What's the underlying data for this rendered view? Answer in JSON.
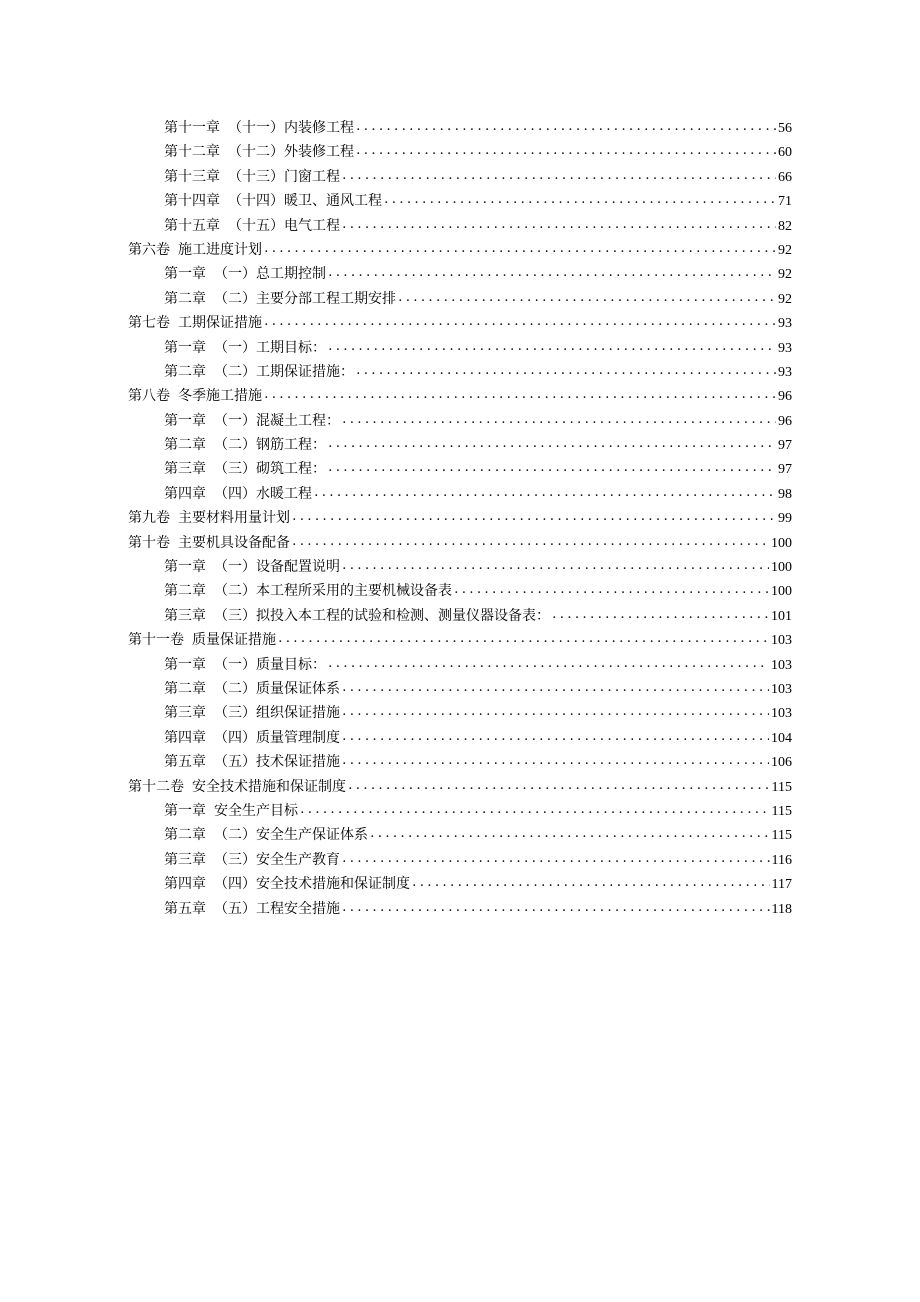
{
  "toc": [
    {
      "level": "chap",
      "label": "第十一章",
      "title": "（十一）内装修工程",
      "page": "56"
    },
    {
      "level": "chap",
      "label": "第十二章",
      "title": "（十二）外装修工程",
      "page": "60"
    },
    {
      "level": "chap",
      "label": "第十三章",
      "title": "（十三）门窗工程",
      "page": "66"
    },
    {
      "level": "chap",
      "label": "第十四章",
      "title": "（十四）暖卫、通风工程",
      "page": "71"
    },
    {
      "level": "chap",
      "label": "第十五章",
      "title": "（十五）电气工程",
      "page": "82"
    },
    {
      "level": "vol",
      "label": "第六卷",
      "title": "施工进度计划",
      "page": "92"
    },
    {
      "level": "chap",
      "label": "第一章",
      "title": "（一）总工期控制",
      "page": "92"
    },
    {
      "level": "chap",
      "label": "第二章",
      "title": "（二）主要分部工程工期安排",
      "page": "92"
    },
    {
      "level": "vol",
      "label": "第七卷",
      "title": "工期保证措施",
      "page": "93"
    },
    {
      "level": "chap",
      "label": "第一章",
      "title": "（一）工期目标：",
      "page": "93"
    },
    {
      "level": "chap",
      "label": "第二章",
      "title": "（二）工期保证措施：",
      "page": "93"
    },
    {
      "level": "vol",
      "label": "第八卷",
      "title": "冬季施工措施",
      "page": "96"
    },
    {
      "level": "chap",
      "label": "第一章",
      "title": "（一）混凝土工程：",
      "page": "96"
    },
    {
      "level": "chap",
      "label": "第二章",
      "title": "（二）钢筋工程：",
      "page": "97"
    },
    {
      "level": "chap",
      "label": "第三章",
      "title": "（三）砌筑工程：",
      "page": "97"
    },
    {
      "level": "chap",
      "label": "第四章",
      "title": "（四）水暖工程",
      "page": "98"
    },
    {
      "level": "vol",
      "label": "第九卷",
      "title": "主要材料用量计划",
      "page": "99"
    },
    {
      "level": "vol",
      "label": "第十卷",
      "title": "主要机具设备配备",
      "page": "100"
    },
    {
      "level": "chap",
      "label": "第一章",
      "title": "（一）设备配置说明",
      "page": "100"
    },
    {
      "level": "chap",
      "label": "第二章",
      "title": "（二）本工程所采用的主要机械设备表",
      "page": "100"
    },
    {
      "level": "chap",
      "label": "第三章",
      "title": "（三）拟投入本工程的试验和检测、测量仪器设备表：",
      "page": "101"
    },
    {
      "level": "vol",
      "label": "第十一卷",
      "title": "质量保证措施",
      "page": "103"
    },
    {
      "level": "chap",
      "label": "第一章",
      "title": "（一）质量目标：",
      "page": "103"
    },
    {
      "level": "chap",
      "label": "第二章",
      "title": "（二）质量保证体系",
      "page": "103"
    },
    {
      "level": "chap",
      "label": "第三章",
      "title": "（三）组织保证措施",
      "page": "103"
    },
    {
      "level": "chap",
      "label": "第四章",
      "title": "（四）质量管理制度",
      "page": "104"
    },
    {
      "level": "chap",
      "label": "第五章",
      "title": "（五）技术保证措施",
      "page": "106"
    },
    {
      "level": "vol",
      "label": "第十二卷",
      "title": "安全技术措施和保证制度",
      "page": "115"
    },
    {
      "level": "chap",
      "label": "第一章",
      "title": "安全生产目标",
      "page": "115"
    },
    {
      "level": "chap",
      "label": "第二章",
      "title": "（二）安全生产保证体系",
      "page": "115"
    },
    {
      "level": "chap",
      "label": "第三章",
      "title": "（三）安全生产教育",
      "page": "116"
    },
    {
      "level": "chap",
      "label": "第四章",
      "title": "（四）安全技术措施和保证制度",
      "page": "117"
    },
    {
      "level": "chap",
      "label": "第五章",
      "title": "（五）工程安全措施",
      "page": "118"
    }
  ]
}
